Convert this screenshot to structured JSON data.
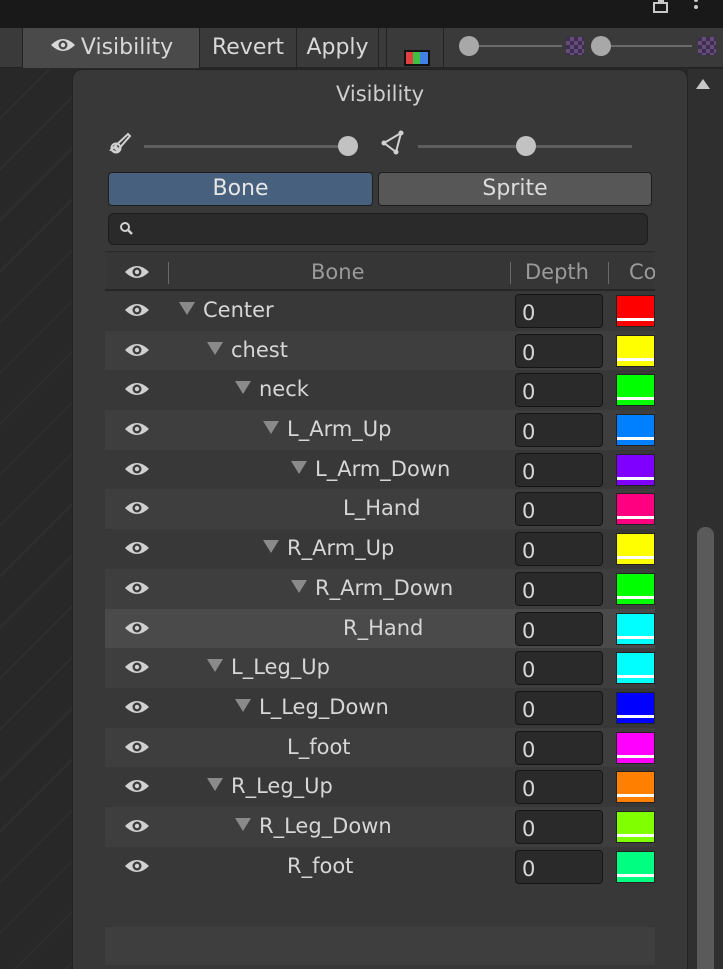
{
  "toolbar": {
    "visibility_label": "Visibility",
    "revert_label": "Revert",
    "apply_label": "Apply"
  },
  "panel": {
    "title": "Visibility",
    "bone_opacity": 1.0,
    "mesh_opacity": 0.5,
    "tabs": {
      "bone": "Bone",
      "sprite": "Sprite"
    },
    "selected_tab": "Bone",
    "search": {
      "value": "",
      "placeholder": ""
    }
  },
  "table": {
    "headers": {
      "bone": "Bone",
      "depth": "Depth",
      "color": "Co"
    },
    "rows": [
      {
        "name": "Center",
        "level": 0,
        "expanded": true,
        "depth": "0",
        "color": "#ff0000"
      },
      {
        "name": "chest",
        "level": 1,
        "expanded": true,
        "depth": "0",
        "color": "#ffff00"
      },
      {
        "name": "neck",
        "level": 2,
        "expanded": true,
        "depth": "0",
        "color": "#00ff00"
      },
      {
        "name": "L_Arm_Up",
        "level": 3,
        "expanded": true,
        "depth": "0",
        "color": "#0080ff"
      },
      {
        "name": "L_Arm_Down",
        "level": 4,
        "expanded": true,
        "depth": "0",
        "color": "#8000ff"
      },
      {
        "name": "L_Hand",
        "level": 5,
        "expanded": false,
        "depth": "0",
        "color": "#ff0080"
      },
      {
        "name": "R_Arm_Up",
        "level": 3,
        "expanded": true,
        "depth": "0",
        "color": "#ffff00"
      },
      {
        "name": "R_Arm_Down",
        "level": 4,
        "expanded": true,
        "depth": "0",
        "color": "#00ff00"
      },
      {
        "name": "R_Hand",
        "level": 5,
        "expanded": false,
        "depth": "0",
        "color": "#00ffff",
        "selected": true
      },
      {
        "name": "L_Leg_Up",
        "level": 1,
        "expanded": true,
        "depth": "0",
        "color": "#00ffff"
      },
      {
        "name": "L_Leg_Down",
        "level": 2,
        "expanded": true,
        "depth": "0",
        "color": "#0000ff"
      },
      {
        "name": "L_foot",
        "level": 3,
        "expanded": false,
        "depth": "0",
        "color": "#ff00ff"
      },
      {
        "name": "R_Leg_Up",
        "level": 1,
        "expanded": true,
        "depth": "0",
        "color": "#ff8000"
      },
      {
        "name": "R_Leg_Down",
        "level": 2,
        "expanded": true,
        "depth": "0",
        "color": "#80ff00"
      },
      {
        "name": "R_foot",
        "level": 3,
        "expanded": false,
        "depth": "0",
        "color": "#00ff80"
      }
    ]
  },
  "colors": {
    "accent": "#46607e",
    "panel_bg": "#383838"
  },
  "icons": [
    "window-icon",
    "more-icon",
    "eye-icon",
    "color-mode-icon",
    "bone-icon",
    "mesh-icon",
    "search-icon",
    "checker-icon"
  ]
}
